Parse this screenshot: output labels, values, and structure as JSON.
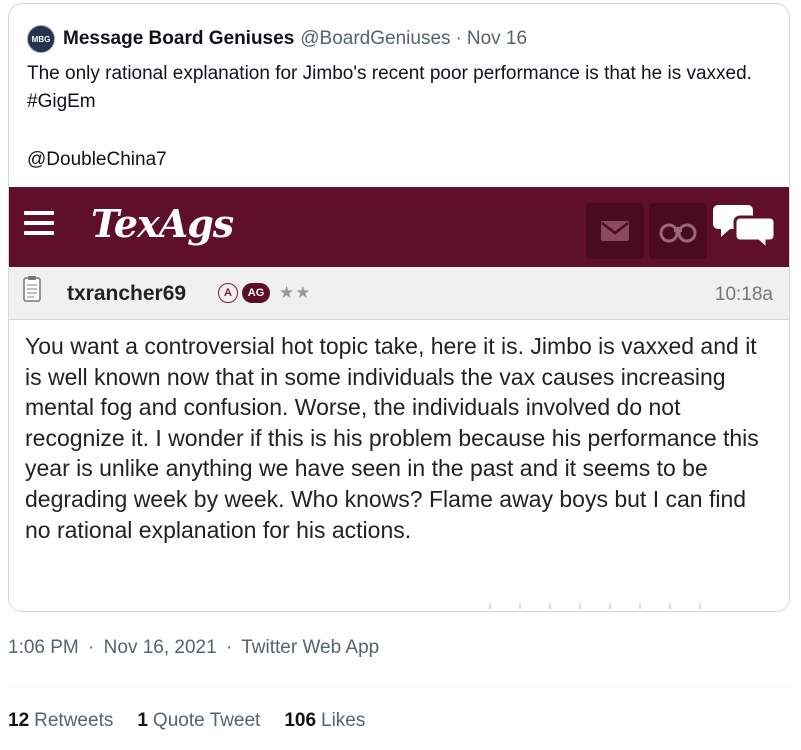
{
  "quote": {
    "avatar_text": "MBG",
    "name": "Message Board Geniuses",
    "handle": "@BoardGeniuses",
    "separator": "·",
    "date": "Nov 16",
    "text": "The only rational explanation for Jimbo's recent poor performance is that he is vaxxed.  #GigEm",
    "mention": "@DoubleChina7"
  },
  "texags": {
    "logo": "TexAgs",
    "brand_color": "#600f2a",
    "icons": [
      "menu-icon",
      "mail-icon",
      "binoculars-icon",
      "chat-icon"
    ],
    "post": {
      "username": "txrancher69",
      "badge_a": "A",
      "badge_ag": "AG",
      "stars": "★★",
      "time": "10:18a",
      "body": "You want a controversial hot topic take, here it is. Jimbo is vaxxed and it is well known now that in some individuals the vax causes increasing mental fog and confusion. Worse, the individuals involved do not recognize it. I wonder if this is his problem because his performance this year is unlike anything we have seen in the past and it seems to be degrading week by week. Who knows? Flame away boys but I can find no rational explanation for his actions."
    }
  },
  "tweet_meta": {
    "time": "1:06 PM",
    "sep1": "·",
    "date": "Nov 16, 2021",
    "sep2": "·",
    "source": "Twitter Web App"
  },
  "stats": {
    "retweets_count": "12",
    "retweets_label": "Retweets",
    "quotes_count": "1",
    "quotes_label": "Quote Tweet",
    "likes_count": "106",
    "likes_label": "Likes"
  }
}
